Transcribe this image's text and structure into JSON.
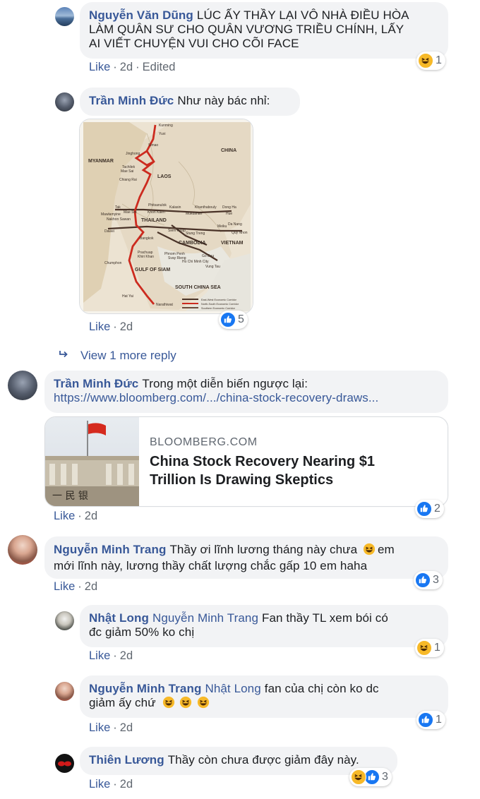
{
  "comments": [
    {
      "author": "Nguyễn Văn Dũng",
      "text": "LÚC ẤY THẦY LẠI VÔ NHÀ ĐIỀU HÒA LÀM QUÂN SƯ CHO QUÂN VƯƠNG TRIỀU CHÍNH, LẤY AI VIẾT CHUYỆN VUI CHO CÕI FACE",
      "line1": "LÚC ẤY THẦY LẠI VÔ NHÀ ĐIỀU HÒA",
      "line2": "LÀM QUÂN SƯ CHO QUÂN VƯƠNG TRIỀU CHÍNH, LẤY",
      "line3": "AI VIẾT CHUYỆN VUI CHO CÕI FACE",
      "like": "Like",
      "time": "2d",
      "edited": "Edited",
      "reaction_count": "1"
    },
    {
      "author": "Trần Minh Đức",
      "text": "Như này bác nhỉ:",
      "like": "Like",
      "time": "2d",
      "reaction_count": "5"
    },
    {
      "author": "Trần Minh Đức",
      "text": "Trong một diễn biến ngược lại:",
      "url": "https://www.bloomberg.com/.../china-stock-recovery-draws...",
      "like": "Like",
      "time": "2d",
      "reaction_count": "2"
    },
    {
      "author": "Nguyễn Minh Trang",
      "line1": "Thầy ơi lĩnh lương tháng này chưa",
      "line1_end": "em",
      "line2": "mới lĩnh này, lương thầy chất lượng chắc gấp 10 em haha",
      "like": "Like",
      "time": "2d",
      "reaction_count": "3"
    },
    {
      "author": "Nhật Long",
      "mention": "Nguyễn Minh Trang",
      "line1": "Fan thầy TL xem bói có",
      "line2": "đc giảm 50% ko chị",
      "like": "Like",
      "time": "2d",
      "reaction_count": "1"
    },
    {
      "author": "Nguyễn Minh Trang",
      "mention": "Nhật Long",
      "line1": "fan của chị còn ko dc",
      "line2": "giảm ấy chứ",
      "like": "Like",
      "time": "2d",
      "reaction_count": "1"
    },
    {
      "author": "Thiên Lương",
      "text": "Thầy còn chưa được giảm đây này.",
      "like": "Like",
      "time": "2d",
      "reaction_count": "3"
    }
  ],
  "view_more_replies": "View 1 more reply",
  "link_card": {
    "domain": "BLOOMBERG.COM",
    "title_line1": "China Stock Recovery Nearing $1",
    "title_line2": "Trillion Is Drawing Skeptics",
    "image_text": "一 民 银"
  },
  "map": {
    "labels": {
      "kunming": "Kunming",
      "yuxi": "Yuxi",
      "simao": "Simao",
      "jinghong": "Jinghong",
      "china": "CHINA",
      "myanmar": "MYANMAR",
      "tachilek": "Tachilek",
      "maesai": "Mae Sai",
      "chiangrai": "Chiang Rai",
      "laos": "LAOS",
      "phitsanulok": "Phitsanulok",
      "kalasin": "Kalasin",
      "khanthabouly": "Khanthabouly",
      "dongha": "Dong Ha",
      "tak": "Tak",
      "maesot": "Mae Sot",
      "khonkaen": "Khon Kaen",
      "mukdahan": "Mukdahan",
      "hue": "Hue",
      "mawlamyine": "Mawlamyine",
      "nakhonsawan": "Nakhon Sawan",
      "thailand": "THAILAND",
      "danang": "Da Nang",
      "meiku": "Meiku",
      "dawei": "Dawei",
      "siemreap": "Siem Reap",
      "stungtreng": "Stung Treng",
      "quynhon": "Quy Nhon",
      "bangkok": "Bangkok",
      "cambodia": "CAMBODIA",
      "vietnam": "VIETNAM",
      "prachuap": "Prachuap",
      "khirikhan": "Khiri Khan",
      "phnompenh": "Phnom Penh",
      "svayrieng": "Svay Rieng",
      "godau": "Go Dau",
      "hcmc": "Ho Chi Minh City",
      "chumphon": "Chumphon",
      "vungtau": "Vung Tau",
      "gulfofsiam": "GULF OF SIAM",
      "southchinasea": "SOUTH CHINA SEA",
      "hatyai": "Hat Yai",
      "narathiwat": "Narathiwat",
      "legend_ew": "East-West Economic Corridor",
      "legend_ns": "North-South Economic Corridor",
      "legend_s": "Southern Economic Corridor"
    }
  },
  "colors": {
    "link": "#385898",
    "bubble": "#f2f3f5",
    "meta": "#606770",
    "like_blue": "#1877f2",
    "haha_yellow": "#f7b928"
  }
}
